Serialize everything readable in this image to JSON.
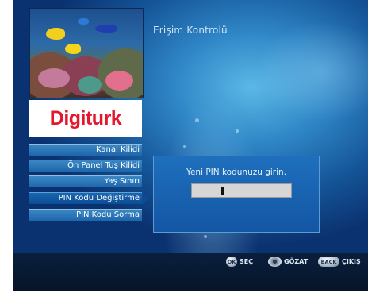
{
  "screen": {
    "title": "Erişim Kontrolü",
    "logo_text": "Digiturk",
    "colors": {
      "accent": "#e3182d",
      "menu": "#1e66ab",
      "dialog": "#1356a4",
      "background": "#145497"
    }
  },
  "menu": {
    "items": [
      {
        "label": "Kanal Kilidi",
        "active": false
      },
      {
        "label": "Ön Panel Tuş Kilidi",
        "active": false
      },
      {
        "label": "Yaş Sınırı",
        "active": false
      },
      {
        "label": "PIN Kodu Değiştirme",
        "active": true
      },
      {
        "label": "PIN Kodu Sorma",
        "active": false
      }
    ]
  },
  "dialog": {
    "prompt": "Yeni PIN kodunuzu girin.",
    "pin_value": ""
  },
  "footer": {
    "ok_key": "OK",
    "ok_label": "SEÇ",
    "nav_icon": "navigation-pad-icon",
    "nav_label": "GÖZAT",
    "back_key": "BACK",
    "back_label": "ÇIKIŞ"
  }
}
